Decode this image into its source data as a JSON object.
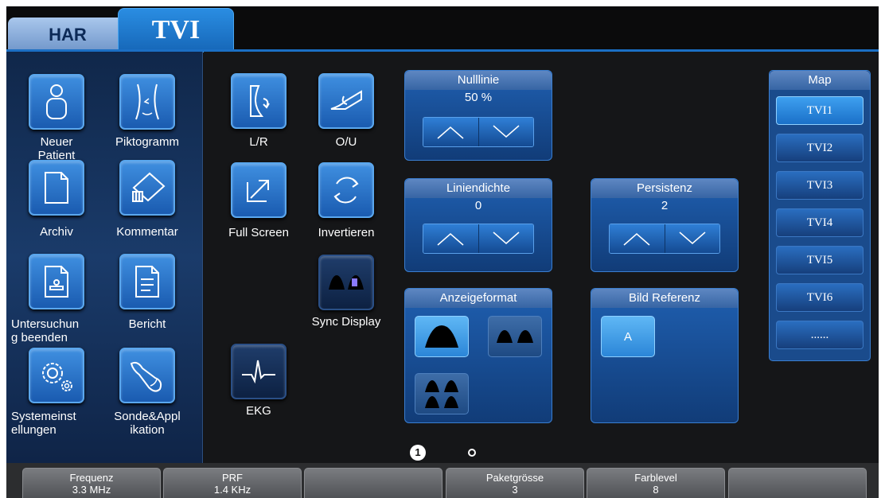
{
  "tabs": [
    {
      "label": "HAR"
    },
    {
      "label": "TVI"
    }
  ],
  "left_buttons": [
    {
      "label": "Neuer Patient",
      "icon": "patient-icon"
    },
    {
      "label": "Piktogramm",
      "icon": "body-outline-icon"
    },
    {
      "label": "Archiv",
      "icon": "document-icon"
    },
    {
      "label": "Kommentar",
      "icon": "comment-tag-icon"
    },
    {
      "label": "Untersuchung beenden",
      "icon": "end-exam-icon"
    },
    {
      "label": "Bericht",
      "icon": "report-icon"
    },
    {
      "label": "Systemeinstellungen",
      "icon": "settings-gears-icon"
    },
    {
      "label": "Sonde&Applikation",
      "icon": "probe-icon"
    }
  ],
  "left_labels": {
    "neuer_patient": "Neuer\nPatient",
    "piktogramm": "Piktogramm",
    "archiv": "Archiv",
    "kommentar": "Kommentar",
    "untersuchung": "Untersuchun\ng beenden",
    "bericht": "Bericht",
    "system": "Systemeinst\nellungen",
    "sonde": "Sonde&Appl\nikation"
  },
  "mid_buttons": {
    "lr": "L/R",
    "ou": "O/U",
    "fullscreen": "Full Screen",
    "invertieren": "Invertieren",
    "sync": "Sync Display",
    "ekg": "EKG"
  },
  "controls": {
    "nulllinie": {
      "title": "Nulllinie",
      "value": "50 %"
    },
    "liniendichte": {
      "title": "Liniendichte",
      "value": "0"
    },
    "persistenz": {
      "title": "Persistenz",
      "value": "2"
    },
    "anzeigeformat": {
      "title": "Anzeigeformat"
    },
    "bild_referenz": {
      "title": "Bild Referenz",
      "button": "A"
    }
  },
  "map": {
    "title": "Map",
    "items": [
      "TVI1",
      "TVI2",
      "TVI3",
      "TVI4",
      "TVI5",
      "TVI6",
      "......"
    ],
    "selected": "TVI1"
  },
  "pager": {
    "current": "1"
  },
  "bottom_bar": [
    {
      "label": "Frequenz",
      "value": "3.3 MHz"
    },
    {
      "label": "PRF",
      "value": "1.4 KHz"
    },
    {
      "label": "",
      "value": ""
    },
    {
      "label": "Paketgrösse",
      "value": "3"
    },
    {
      "label": "Farblevel",
      "value": "8"
    },
    {
      "label": "",
      "value": ""
    }
  ],
  "colors": {
    "accent": "#1b6fc4",
    "panel": "#1a4b8c",
    "background": "#151618"
  }
}
